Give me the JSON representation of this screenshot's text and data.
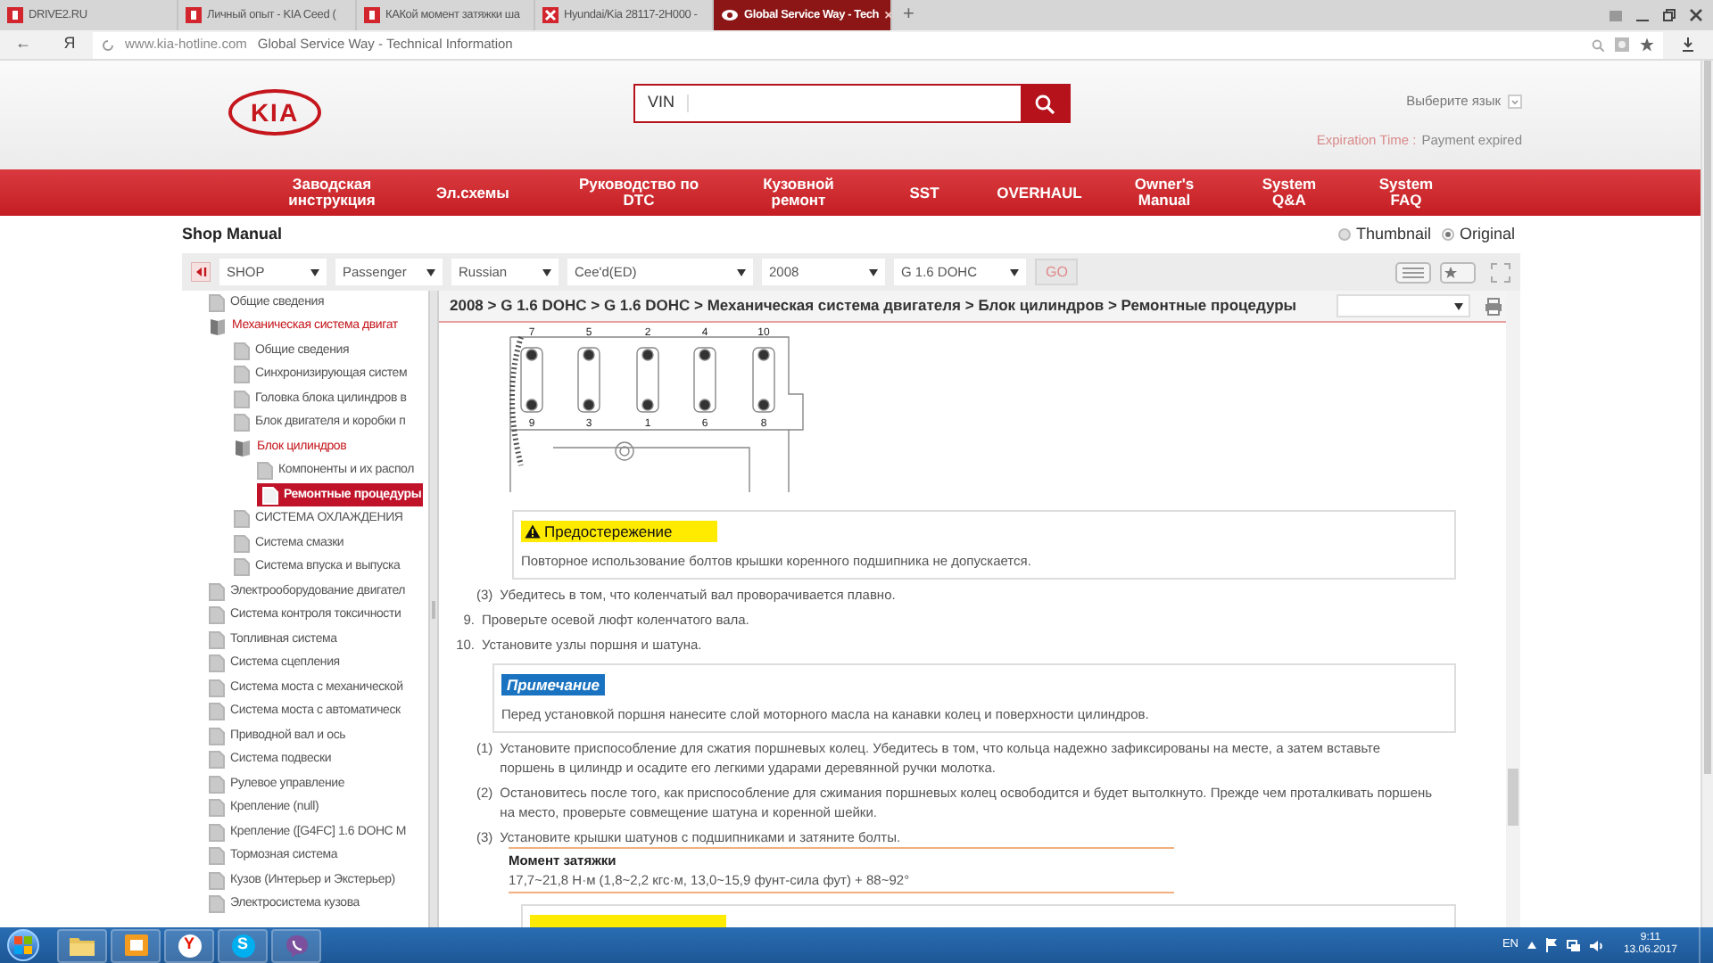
{
  "browser": {
    "tabs": [
      {
        "label": "DRIVE2.RU",
        "kind": "drive2",
        "selected": false
      },
      {
        "label": "Личный опыт - KIA Ceed (",
        "kind": "drive2",
        "selected": false
      },
      {
        "label": "КАКой момент затяжки ша",
        "kind": "drive2",
        "selected": false
      },
      {
        "label": "Hyundai/Kia 28117-2H000 -",
        "kind": "exist",
        "selected": false
      },
      {
        "label": "Global Service Way - Tech",
        "kind": "eye",
        "selected": true
      }
    ],
    "new_tab": "+",
    "close": "×",
    "address": {
      "back": "←",
      "yandex": "Я",
      "domain": "www.kia-hotline.com",
      "title": "Global Service Way - Technical Information"
    }
  },
  "header": {
    "logo": "KIA",
    "search": {
      "value": "VIN"
    },
    "language": "Выберите язык",
    "expiration": {
      "label": "Expiration Time :",
      "value": "Payment expired"
    }
  },
  "menu": [
    {
      "lines": [
        "Заводская",
        "инструкция"
      ]
    },
    {
      "lines": [
        "Эл.схемы"
      ]
    },
    {
      "lines": [
        "Руководство по",
        "DTC"
      ]
    },
    {
      "lines": [
        "Кузовной",
        "ремонт"
      ]
    },
    {
      "lines": [
        "SST"
      ]
    },
    {
      "lines": [
        "OVERHAUL"
      ]
    },
    {
      "lines": [
        "Owner's",
        "Manual"
      ]
    },
    {
      "lines": [
        "System",
        "Q&A"
      ]
    },
    {
      "lines": [
        "System",
        "FAQ"
      ]
    }
  ],
  "shop_manual": {
    "title": "Shop Manual",
    "views": [
      {
        "label": "Thumbnail",
        "selected": false
      },
      {
        "label": "Original",
        "selected": true
      }
    ],
    "filters": [
      {
        "value": "SHOP"
      },
      {
        "value": "Passenger"
      },
      {
        "value": "Russian"
      },
      {
        "value": "Cee'd(ED)"
      },
      {
        "value": "2008"
      },
      {
        "value": "G 1.6 DOHC"
      }
    ],
    "go": "GO"
  },
  "tree": [
    {
      "label": "Общие сведения",
      "selected": false
    },
    {
      "label": "Механическая система двигат",
      "selected": false,
      "expanded": true,
      "children": [
        {
          "label": "Общие сведения",
          "selected": false
        },
        {
          "label": "Синхронизирующая систем",
          "selected": false
        },
        {
          "label": "Головка блока цилиндров в",
          "selected": false
        },
        {
          "label": "Блок двигателя и коробки п",
          "selected": false
        },
        {
          "label": "Блок цилиндров",
          "selected": false,
          "expanded": true,
          "children": [
            {
              "label": "Компоненты и их распол",
              "selected": false
            },
            {
              "label": "Ремонтные процедуры",
              "selected": true
            }
          ]
        },
        {
          "label": "СИСТЕМА ОХЛАЖДЕНИЯ",
          "selected": false
        },
        {
          "label": "Система смазки",
          "selected": false
        },
        {
          "label": "Система впуска и выпуска",
          "selected": false
        }
      ]
    },
    {
      "label": "Электрооборудование двигател",
      "selected": false
    },
    {
      "label": "Система контроля токсичности",
      "selected": false
    },
    {
      "label": "Топливная система",
      "selected": false
    },
    {
      "label": "Система сцепления",
      "selected": false
    },
    {
      "label": "Система моста с механической",
      "selected": false
    },
    {
      "label": "Система моста с автоматическ",
      "selected": false
    },
    {
      "label": "Приводной вал и ось",
      "selected": false
    },
    {
      "label": "Система подвески",
      "selected": false
    },
    {
      "label": "Рулевое управление",
      "selected": false
    },
    {
      "label": "Крепление (null)",
      "selected": false
    },
    {
      "label": "Крепление ([G4FC] 1.6 DOHC M",
      "selected": false
    },
    {
      "label": "Тормозная система",
      "selected": false
    },
    {
      "label": "Кузов (Интерьер и Экстерьер)",
      "selected": false
    },
    {
      "label": "Электросистема кузова",
      "selected": false
    }
  ],
  "content": {
    "breadcrumb": "2008 > G 1.6 DOHC > G 1.6 DOHC > Механическая система двигателя > Блок цилиндров > Ремонтные процедуры",
    "blocks": [
      {
        "kind": "figure",
        "top_labels": [
          "7",
          "5",
          "2",
          "4",
          "10"
        ],
        "bottom_labels": [
          "9",
          "3",
          "1",
          "6",
          "8"
        ]
      },
      {
        "kind": "caution",
        "title": "Предостережение",
        "text": "Повторное использование болтов крышки коренного подшипника не допускается."
      },
      {
        "kind": "substep",
        "number": "(3)",
        "text": "Убедитесь в том, что коленчатый вал проворачивается плавно."
      },
      {
        "kind": "step",
        "number": "9.",
        "text": "Проверьте осевой люфт коленчатого вала."
      },
      {
        "kind": "step",
        "number": "10.",
        "text": "Установите узлы поршня и шатуна."
      },
      {
        "kind": "note",
        "title": "Примечание",
        "text": "Перед установкой поршня нанесите слой моторного масла на канавки колец и поверхности цилиндров."
      },
      {
        "kind": "substep",
        "number": "(1)",
        "text": "Установите приспособление для сжатия поршневых колец. Убедитесь в том, что кольца надежно зафиксированы на месте, а затем вставьте поршень в цилиндр и осадите его легкими ударами деревянной ручки молотка."
      },
      {
        "kind": "substep",
        "number": "(2)",
        "text": "Остановитесь после того, как приспособление для сжимания поршневых колец освободится и будет вытолкнуто. Прежде чем проталкивать поршень на место, проверьте совмещение шатуна и коренной шейки."
      },
      {
        "kind": "substep",
        "number": "(3)",
        "text": "Установите крышки шатунов с подшипниками и затяните болты."
      },
      {
        "kind": "torque",
        "title": "Момент затяжки",
        "text": "17,7~21,8 Н·м (1,8~2,2 кгс·м, 13,0~15,9 фунт-сила фут) + 88~92°"
      },
      {
        "kind": "caution"
      }
    ]
  },
  "taskbar": {
    "apps": [
      {
        "kind": "folder"
      },
      {
        "kind": "mail"
      },
      {
        "kind": "yandex",
        "glyph": "Y"
      },
      {
        "kind": "skype",
        "glyph": "S"
      },
      {
        "kind": "viber"
      }
    ],
    "language": "EN",
    "time": "9:11",
    "date": "13.06.2017"
  }
}
